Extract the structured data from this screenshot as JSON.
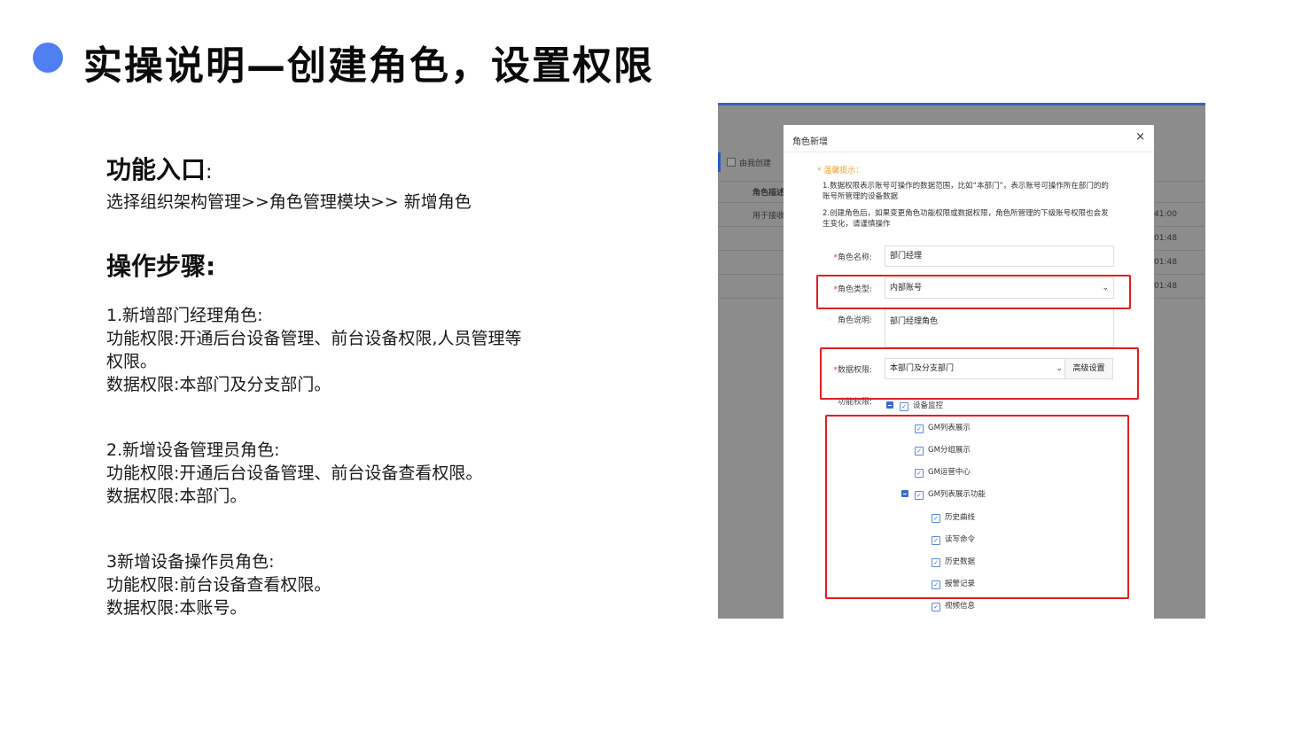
{
  "slide": {
    "title": "实操说明—创建角色，设置权限"
  },
  "left": {
    "entry_heading": "功能入口",
    "entry_colon": ":",
    "entry_path": "选择组织架构管理>>角色管理模块>> 新增角色",
    "steps_heading": "操作步骤:",
    "step1": {
      "line1": "1.新增部门经理角色:",
      "line2": "功能权限:开通后台设备管理、前台设备权限,人员管理等",
      "line3": "权限。",
      "line4": "数据权限:本部门及分支部门。"
    },
    "step2": {
      "line1": "2.新增设备管理员角色:",
      "line2": "功能权限:开通后台设备管理、前台设备查看权限。",
      "line3": "数据权限:本部门。"
    },
    "step3": {
      "line1": "3新增设备操作员角色:",
      "line2": "功能权限:前台设备查看权限。",
      "line3": "数据权限:本账号。"
    }
  },
  "screenshot": {
    "background": {
      "filter_label": "由我创建",
      "col_header": "角色描述",
      "row1_text": "用于接收",
      "times": [
        "41:00",
        "01:48",
        "01:48",
        "01:48"
      ]
    },
    "modal": {
      "title": "角色新增",
      "close": "×",
      "tip_heading": "* 温馨提示：",
      "tip1": "1.数据权限表示账号可操作的数据范围，比如“本部门”，表示账号可操作所在部门的的账号所管理的设备数据",
      "tip2": "2.创建角色后，如果变更角色功能权限或数据权限，角色所管理的下级账号权限也会发生变化，请谨慎操作",
      "form": {
        "name_label": "角色名称:",
        "name_value": "部门经理",
        "type_label": "角色类型:",
        "type_value": "内部账号",
        "desc_label": "角色说明:",
        "desc_value": "部门经理角色",
        "data_label": "数据权限:",
        "data_value": "本部门及分支部门",
        "adv_button": "高级设置",
        "func_label": "功能权限:"
      },
      "tree": {
        "root": "设备监控",
        "items": [
          "GM列表展示",
          "GM分组展示",
          "GM运营中心"
        ],
        "group": "GM列表展示功能",
        "sub_items": [
          "历史曲线",
          "读写命令",
          "历史数据",
          "报警记录",
          "视频信息"
        ]
      }
    }
  },
  "colors": {
    "accent_dot": "#4f7ff0",
    "highlight_red": "#e02020",
    "tip_orange": "#f0a020"
  }
}
